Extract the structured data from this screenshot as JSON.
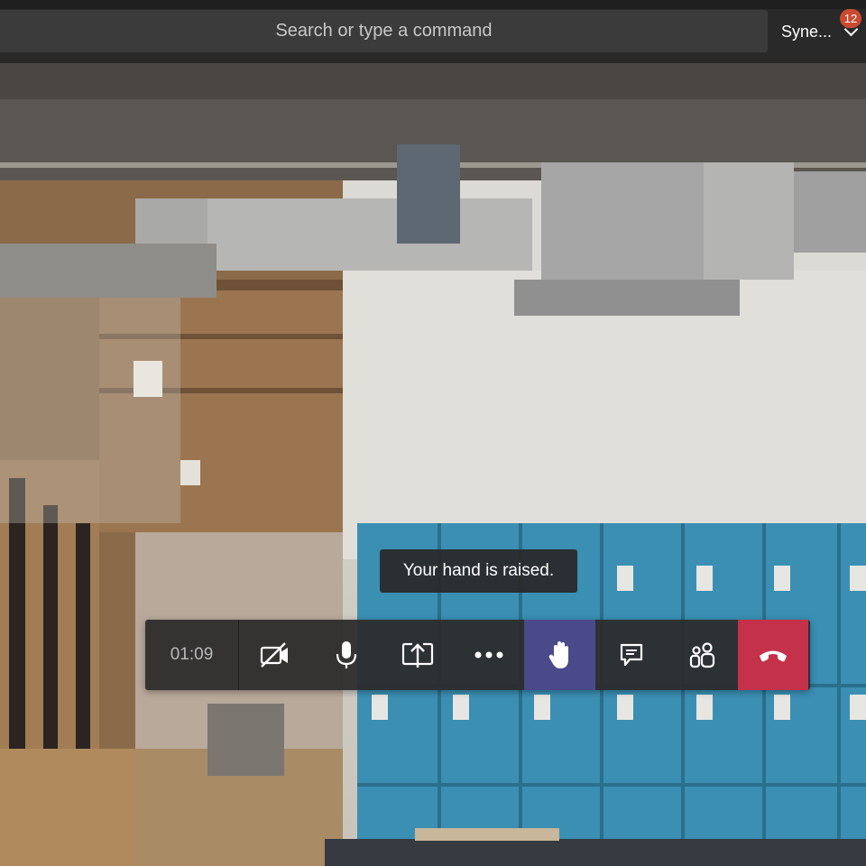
{
  "header": {
    "search_placeholder": "Search or type a command",
    "account_name": "Syne...",
    "notification_count": "12"
  },
  "call": {
    "timer": "01:09",
    "controls": [
      {
        "name": "camera-off",
        "icon": "video-off-icon"
      },
      {
        "name": "microphone",
        "icon": "microphone-icon"
      },
      {
        "name": "share",
        "icon": "share-screen-icon"
      },
      {
        "name": "more",
        "icon": "more-options-icon"
      },
      {
        "name": "raise-hand",
        "icon": "raised-hand-icon",
        "active": true
      },
      {
        "name": "chat",
        "icon": "chat-icon"
      },
      {
        "name": "participants",
        "icon": "participants-icon"
      },
      {
        "name": "hang-up",
        "icon": "hang-up-icon"
      }
    ],
    "tooltip": "Your hand is raised."
  },
  "colors": {
    "raised_hand_bg": "#4a4a8a",
    "hang_up_bg": "#c4314b",
    "badge_bg": "#cc4a31"
  }
}
